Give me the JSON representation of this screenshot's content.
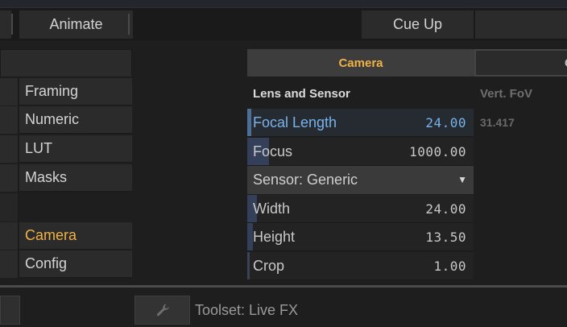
{
  "top_menu": {
    "animate_label": "Animate",
    "cueup_label": "Cue Up"
  },
  "nav": {
    "items": [
      {
        "label": "Framing"
      },
      {
        "label": "Numeric"
      },
      {
        "label": "LUT"
      },
      {
        "label": "Masks"
      },
      {
        "label": "Camera",
        "active": true
      },
      {
        "label": "Config"
      }
    ]
  },
  "panel": {
    "tab_active": "Camera",
    "tab_other_partial": "C",
    "section_title": "Lens and Sensor",
    "side_label": "Vert. FoV",
    "side_value": "31.417",
    "params": {
      "focal_length": {
        "label": "Focal Length",
        "value": "24.00"
      },
      "focus": {
        "label": "Focus",
        "value": "1000.00"
      },
      "sensor": {
        "label": "Sensor: Generic"
      },
      "width": {
        "label": "Width",
        "value": "24.00"
      },
      "height": {
        "label": "Height",
        "value": "13.50"
      },
      "crop": {
        "label": "Crop",
        "value": "1.00"
      }
    }
  },
  "status": {
    "toolset_label": "Toolset: Live FX"
  },
  "colors": {
    "accent": "#f1b245",
    "highlight": "#79b3ec",
    "background": "#1e1e1e"
  },
  "icons": {
    "dropdown": "triangle-down-icon",
    "wrench": "wrench-icon"
  }
}
